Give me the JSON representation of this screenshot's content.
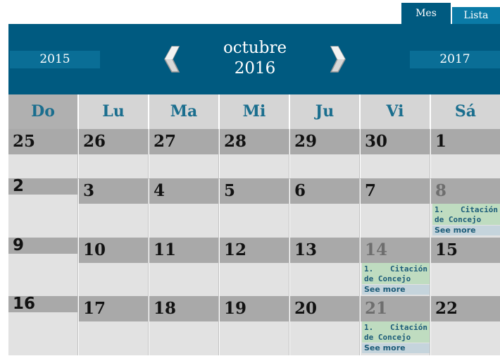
{
  "tabs": {
    "month": "Mes",
    "list": "Lista"
  },
  "header": {
    "prev_year": "2015",
    "next_year": "2017",
    "month": "octubre",
    "year": "2016"
  },
  "weekdays": [
    "Do",
    "Lu",
    "Ma",
    "Mi",
    "Ju",
    "Vi",
    "Sá"
  ],
  "weeks": [
    {
      "days": [
        {
          "n": "25",
          "muted": false
        },
        {
          "n": "26",
          "muted": false
        },
        {
          "n": "27",
          "muted": false
        },
        {
          "n": "28",
          "muted": false
        },
        {
          "n": "29",
          "muted": false
        },
        {
          "n": "30",
          "muted": false
        },
        {
          "n": "1",
          "muted": false
        }
      ]
    },
    {
      "days": [
        {
          "n": "2",
          "muted": false
        },
        {
          "n": "3",
          "muted": false
        },
        {
          "n": "4",
          "muted": false
        },
        {
          "n": "5",
          "muted": false
        },
        {
          "n": "6",
          "muted": false
        },
        {
          "n": "7",
          "muted": false
        },
        {
          "n": "8",
          "muted": true,
          "event": {
            "number": "1.",
            "word": "Citación",
            "line2": "de Concejo",
            "more": "See more"
          }
        }
      ]
    },
    {
      "days": [
        {
          "n": "9",
          "muted": false
        },
        {
          "n": "10",
          "muted": false
        },
        {
          "n": "11",
          "muted": false
        },
        {
          "n": "12",
          "muted": false
        },
        {
          "n": "13",
          "muted": false
        },
        {
          "n": "14",
          "muted": true,
          "event": {
            "number": "1.",
            "word": "Citación",
            "line2": "de Concejo",
            "more": "See more"
          }
        },
        {
          "n": "15",
          "muted": false
        }
      ]
    },
    {
      "days": [
        {
          "n": "16",
          "muted": false
        },
        {
          "n": "17",
          "muted": false
        },
        {
          "n": "18",
          "muted": false
        },
        {
          "n": "19",
          "muted": false
        },
        {
          "n": "20",
          "muted": false
        },
        {
          "n": "21",
          "muted": true,
          "event": {
            "number": "1.",
            "word": "Citación",
            "line2": "de Concejo",
            "more": "See more"
          }
        },
        {
          "n": "22",
          "muted": false
        }
      ]
    }
  ]
}
